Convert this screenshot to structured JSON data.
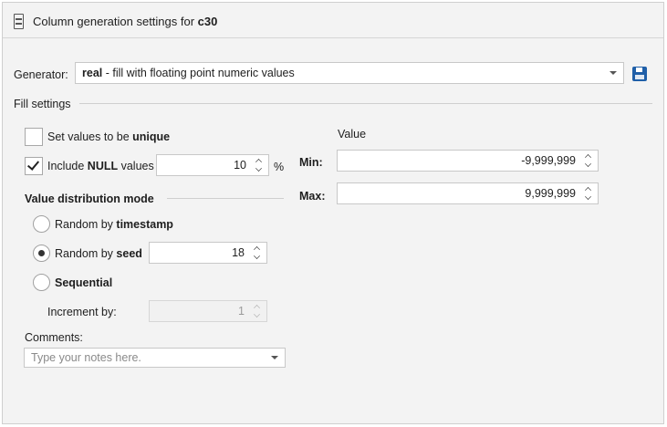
{
  "header": {
    "icon": "column-icon",
    "title_prefix": "Column generation settings for",
    "column_name": "c30"
  },
  "generator": {
    "label": "Generator:",
    "type_name": "real",
    "type_description": " - fill with floating point numeric values",
    "save_icon": "save-icon"
  },
  "fill_settings": {
    "section_label": "Fill settings",
    "unique": {
      "label_prefix": "Set values to be",
      "label_bold": "unique",
      "checked": false
    },
    "include_null": {
      "label_prefix": "Include",
      "label_bold": "NULL",
      "label_suffix": "values",
      "checked": true,
      "value": "10",
      "unit": "%"
    },
    "distribution": {
      "section_label": "Value distribution mode",
      "options": [
        {
          "prefix": "Random by",
          "bold": "timestamp",
          "selected": false
        },
        {
          "prefix": "Random by",
          "bold": "seed",
          "selected": true,
          "value": "18"
        },
        {
          "prefix": "",
          "bold": "Sequential",
          "selected": false
        }
      ],
      "increment_label": "Increment by:",
      "increment_value": "1"
    },
    "value": {
      "section_label": "Value",
      "min_label": "Min:",
      "min_value": "-9,999,999",
      "max_label": "Max:",
      "max_value": "9,999,999"
    },
    "comments": {
      "label": "Comments:",
      "placeholder": "Type your notes here."
    }
  },
  "colors": {
    "accent": "#1f5fa8",
    "panel_bg": "#f3f3f3"
  }
}
